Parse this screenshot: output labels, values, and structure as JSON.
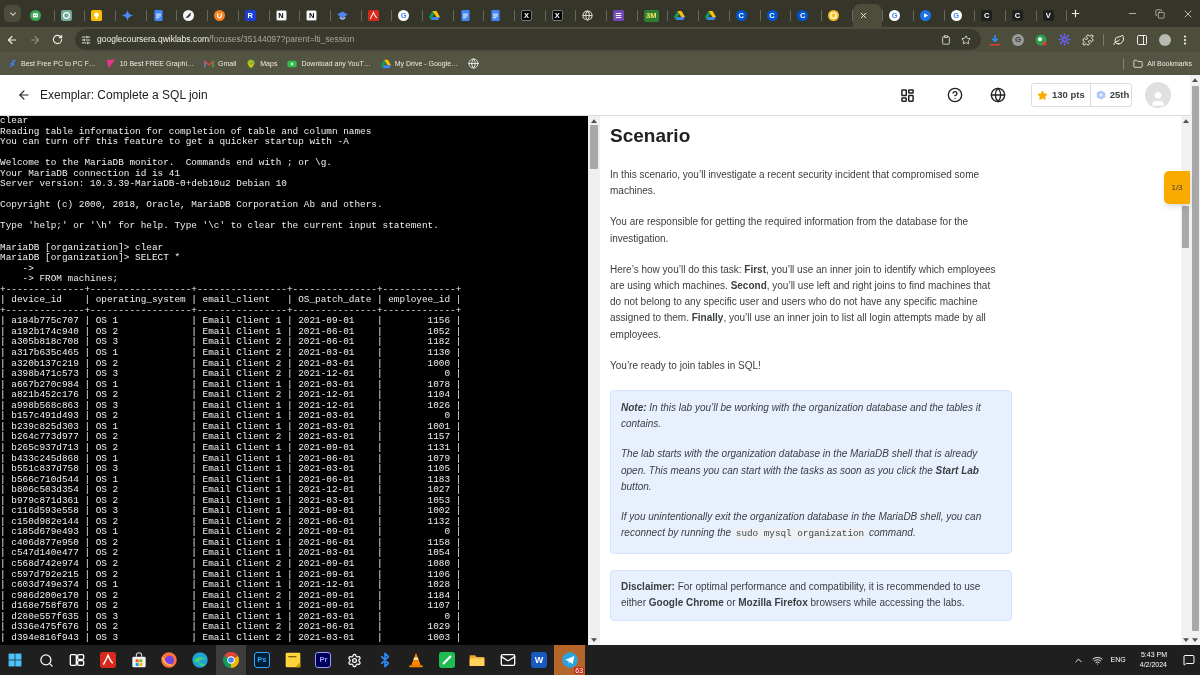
{
  "browser": {
    "tabs": [
      {
        "kind": "bot",
        "selected": false
      },
      {
        "kind": "knot",
        "selected": false
      },
      {
        "kind": "bulb",
        "selected": false
      },
      {
        "kind": "sparkle",
        "selected": false
      },
      {
        "kind": "doc",
        "selected": false
      },
      {
        "kind": "feather",
        "selected": false
      },
      {
        "kind": "udisc",
        "selected": false
      },
      {
        "kind": "square",
        "glyph": "R",
        "selected": false
      },
      {
        "kind": "notion",
        "glyph": "N",
        "selected": false
      },
      {
        "kind": "notion",
        "glyph": "N",
        "selected": false
      },
      {
        "kind": "cap",
        "selected": false
      },
      {
        "kind": "pdf",
        "selected": false
      },
      {
        "kind": "google",
        "glyph": "G",
        "selected": false
      },
      {
        "kind": "drive",
        "selected": false
      },
      {
        "kind": "doc",
        "selected": false
      },
      {
        "kind": "doc",
        "selected": false
      },
      {
        "kind": "xsquare",
        "glyph": "X",
        "selected": false
      },
      {
        "kind": "xsquare",
        "glyph": "X",
        "selected": false
      },
      {
        "kind": "globe",
        "selected": false
      },
      {
        "kind": "list",
        "selected": false
      },
      {
        "kind": "tree",
        "glyph": "3M",
        "selected": false
      },
      {
        "kind": "drive",
        "selected": false
      },
      {
        "kind": "drive",
        "selected": false
      },
      {
        "kind": "coursera",
        "glyph": "C",
        "selected": false
      },
      {
        "kind": "coursera",
        "glyph": "C",
        "selected": false
      },
      {
        "kind": "coursera",
        "glyph": "C",
        "selected": false
      },
      {
        "kind": "ring",
        "selected": false
      },
      {
        "kind": "blank",
        "selected": true
      },
      {
        "kind": "google",
        "glyph": "G",
        "selected": false
      },
      {
        "kind": "bubble",
        "selected": false
      },
      {
        "kind": "google",
        "glyph": "G",
        "selected": false
      },
      {
        "kind": "dark",
        "glyph": "C",
        "selected": false
      },
      {
        "kind": "dark",
        "glyph": "C",
        "selected": false
      },
      {
        "kind": "dark",
        "glyph": "V",
        "selected": false
      }
    ],
    "address": {
      "host": "googlecoursera.qwiklabs.com",
      "path": "/focuses/35144097?parent=lti_session"
    },
    "extensions": [
      {
        "kind": "download"
      },
      {
        "kind": "letter",
        "glyph": "G"
      },
      {
        "kind": "blob"
      },
      {
        "kind": "sun"
      },
      {
        "kind": "puzzle"
      }
    ],
    "bookmarks": [
      {
        "kind": "feather",
        "label": "Best Free PC to PC F…"
      },
      {
        "kind": "flag",
        "label": "10 Best FREE Graphi…"
      },
      {
        "kind": "mail",
        "label": "Gmail"
      },
      {
        "kind": "pin",
        "label": "Maps"
      },
      {
        "kind": "video",
        "label": "Download any YouT…"
      },
      {
        "kind": "drive",
        "label": "My Drive - Google…"
      },
      {
        "kind": "globe"
      }
    ],
    "all_bookmarks": "All Bookmarks"
  },
  "header": {
    "title": "Exemplar: Complete a SQL join",
    "points": "130 pts",
    "rank": "25th"
  },
  "terminal": {
    "blocks": [
      [
        "clear",
        "Reading table information for completion of table and column names",
        "You can turn off this feature to get a quicker startup with -A"
      ],
      [
        "Welcome to the MariaDB monitor.  Commands end with ; or \\g.",
        "Your MariaDB connection id is 41",
        "Server version: 10.3.39-MariaDB-0+deb10u2 Debian 10"
      ],
      [
        "Copyright (c) 2000, 2018, Oracle, MariaDB Corporation Ab and others."
      ],
      [
        "Type 'help;' or '\\h' for help. Type '\\c' to clear the current input statement."
      ],
      [
        "MariaDB [organization]> clear",
        "MariaDB [organization]> SELECT *",
        "    ->",
        "    -> FROM machines;",
        "+--------------+------------------+----------------+---------------+-------------+",
        "| device_id    | operating_system | email_client   | OS_patch_date | employee_id |",
        "+--------------+------------------+----------------+---------------+-------------+",
        "| a184b775c707 | OS 1             | Email Client 1 | 2021-09-01    |        1156 |",
        "| a192b174c940 | OS 2             | Email Client 1 | 2021-06-01    |        1052 |",
        "| a305b818c708 | OS 3             | Email Client 2 | 2021-06-01    |        1182 |",
        "| a317b635c465 | OS 1             | Email Client 2 | 2021-03-01    |        1130 |",
        "| a320b137c219 | OS 2             | Email Client 2 | 2021-03-01    |        1000 |",
        "| a398b471c573 | OS 3             | Email Client 2 | 2021-12-01    |           0 |",
        "| a667b270c984 | OS 1             | Email Client 1 | 2021-03-01    |        1078 |",
        "| a821b452c176 | OS 2             | Email Client 2 | 2021-12-01    |        1104 |",
        "| a998b568c863 | OS 3             | Email Client 1 | 2021-12-01    |        1026 |",
        "| b157c491d493 | OS 2             | Email Client 1 | 2021-03-01    |           0 |",
        "| b239c825d303 | OS 1             | Email Client 1 | 2021-03-01    |        1001 |",
        "| b264c773d977 | OS 2             | Email Client 2 | 2021-03-01    |        1157 |",
        "| b265c937d713 | OS 2             | Email Client 1 | 2021-09-01    |        1131 |",
        "| b433c245d868 | OS 1             | Email Client 1 | 2021-06-01    |        1079 |",
        "| b551c837d758 | OS 3             | Email Client 1 | 2021-03-01    |        1105 |",
        "| b566c710d544 | OS 1             | Email Client 1 | 2021-06-01    |        1183 |",
        "| b806c503d354 | OS 2             | Email Client 1 | 2021-12-01    |        1027 |",
        "| b979c871d361 | OS 2             | Email Client 1 | 2021-03-01    |        1053 |",
        "| c116d593e558 | OS 3             | Email Client 1 | 2021-09-01    |        1002 |",
        "| c150d982e144 | OS 2             | Email Client 2 | 2021-06-01    |        1132 |",
        "| c185d679e493 | OS 1             | Email Client 2 | 2021-09-01    |           0 |",
        "| c406d877e950 | OS 2             | Email Client 1 | 2021-06-01    |        1158 |",
        "| c547d140e477 | OS 2             | Email Client 1 | 2021-03-01    |        1054 |",
        "| c568d742e974 | OS 2             | Email Client 2 | 2021-09-01    |        1080 |",
        "| c597d792e215 | OS 2             | Email Client 1 | 2021-09-01    |        1106 |",
        "| c603d749e374 | OS 1             | Email Client 1 | 2021-12-01    |        1028 |",
        "| c986d200e170 | OS 2             | Email Client 2 | 2021-09-01    |        1184 |",
        "| d168e758f876 | OS 2             | Email Client 1 | 2021-09-01    |        1107 |",
        "| d280e557f635 | OS 3             | Email Client 1 | 2021-03-01    |           0 |",
        "| d336e475f676 | OS 2             | Email Client 2 | 2021-06-01    |        1029 |",
        "| d394e816f943 | OS 3             | Email Client 2 | 2021-03-01    |        1003 |"
      ]
    ]
  },
  "instructions": {
    "heading": "Scenario",
    "paragraphs": [
      "In this scenario, you’ll investigate a recent security incident that compromised some machines.",
      "You are responsible for getting the required information from the database for the investigation.",
      "Here’s how you’ll do this task: **First**, you’ll use an inner join to identify which employees are using which machines. **Second**, you’ll use left and right joins to find machines that do not belong to any specific user and users who do not have any specific machine assigned to them. **Finally**, you’ll use an inner join to list all login attempts made by all employees.",
      "You’re ready to join tables in SQL!"
    ],
    "note": [
      {
        "text": "**Note:** In this lab you’ll be working with the organization database and the tables it contains."
      },
      {
        "text": "The lab starts with the organization database in the MariaDB shell that is already open. This means you can start with the tasks as soon as you click the **Start Lab** button."
      },
      {
        "text": "If you unintentionally exit the organization database in the MariaDB shell, you can reconnect by running the",
        "code": "sudo mysql organization",
        "after": "command."
      }
    ],
    "disclaimer": "**Disclaimer:** For optimal performance and compatibility, it is recommended to use either **Google Chrome** or **Mozilla Firefox** browsers while accessing the labs.",
    "progress": "1/3"
  },
  "taskbar": {
    "apps": [
      {
        "kind": "start",
        "selected": false,
        "flashing": false
      },
      {
        "kind": "search",
        "selected": false,
        "flashing": false
      },
      {
        "kind": "taskview",
        "selected": false,
        "flashing": false
      },
      {
        "kind": "pdf",
        "selected": false,
        "flashing": false
      },
      {
        "kind": "store",
        "selected": false,
        "flashing": false
      },
      {
        "kind": "fox",
        "selected": false,
        "flashing": false
      },
      {
        "kind": "swirl",
        "selected": false,
        "flashing": false
      },
      {
        "kind": "chrome",
        "selected": true,
        "flashing": false
      },
      {
        "kind": "ps",
        "glyph": "Ps",
        "selected": false,
        "flashing": false
      },
      {
        "kind": "sticky",
        "selected": false,
        "flashing": false
      },
      {
        "kind": "pr",
        "glyph": "Pr",
        "selected": false,
        "flashing": false
      },
      {
        "kind": "gear",
        "selected": false,
        "flashing": false
      },
      {
        "kind": "bluetooth",
        "selected": false,
        "flashing": false
      },
      {
        "kind": "cone",
        "selected": false,
        "flashing": false
      },
      {
        "kind": "pentile",
        "selected": false,
        "flashing": false
      },
      {
        "kind": "folder",
        "selected": false,
        "flashing": false
      },
      {
        "kind": "mail",
        "selected": false,
        "flashing": false
      },
      {
        "kind": "word",
        "glyph": "W",
        "selected": false,
        "flashing": false
      },
      {
        "kind": "plane",
        "badge": "63",
        "selected": false,
        "flashing": true
      }
    ],
    "language": "ENG",
    "time": "5:43 PM",
    "date": "4/2/2024"
  }
}
